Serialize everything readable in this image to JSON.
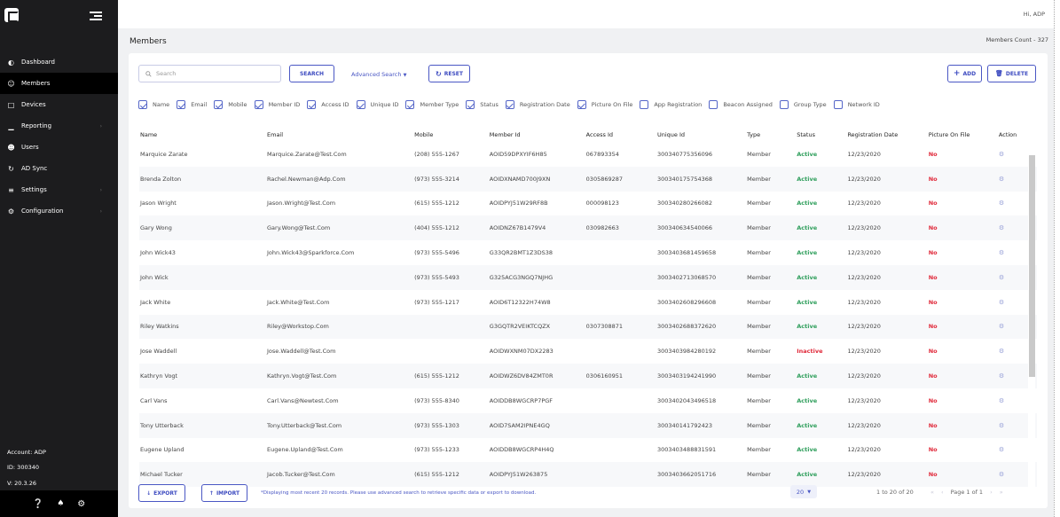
{
  "header": {
    "greeting": "Hi, ADP"
  },
  "sidebar": {
    "items": [
      {
        "label": "Dashboard",
        "icon": "palette-icon"
      },
      {
        "label": "Members",
        "icon": "members-icon"
      },
      {
        "label": "Devices",
        "icon": "device-icon"
      },
      {
        "label": "Reporting",
        "icon": "chart-icon"
      },
      {
        "label": "Users",
        "icon": "user-icon"
      },
      {
        "label": "AD Sync",
        "icon": "sync-icon"
      },
      {
        "label": "Settings",
        "icon": "sliders-icon"
      },
      {
        "label": "Configuration",
        "icon": "gear-icon"
      }
    ],
    "account": "Account: ADP",
    "id": "ID: 300340",
    "version": "V: 20.3.26"
  },
  "page": {
    "title": "Members",
    "count": "Members Count - 327"
  },
  "toolbar": {
    "search_placeholder": "Search",
    "search_button": "SEARCH",
    "advanced": "Advanced Search",
    "reset": "RESET",
    "add": "ADD",
    "delete": "DELETE"
  },
  "filters": [
    {
      "label": "Name",
      "checked": true
    },
    {
      "label": "Email",
      "checked": true
    },
    {
      "label": "Mobile",
      "checked": true
    },
    {
      "label": "Member ID",
      "checked": true
    },
    {
      "label": "Access ID",
      "checked": true
    },
    {
      "label": "Unique ID",
      "checked": true
    },
    {
      "label": "Member Type",
      "checked": true
    },
    {
      "label": "Status",
      "checked": true
    },
    {
      "label": "Registration Date",
      "checked": true
    },
    {
      "label": "Picture On File",
      "checked": true
    },
    {
      "label": "App Registration",
      "checked": false
    },
    {
      "label": "Beacon Assigned",
      "checked": false
    },
    {
      "label": "Group Type",
      "checked": false
    },
    {
      "label": "Network ID",
      "checked": false
    }
  ],
  "table": {
    "columns": [
      "Name",
      "Email",
      "Mobile",
      "Member Id",
      "Access Id",
      "Unique Id",
      "Type",
      "Status",
      "Registration Date",
      "Picture On File",
      "Action"
    ],
    "rows": [
      [
        "Marquice Zarate",
        "Marquice.Zarate@Test.Com",
        "(208) 555-1267",
        "AOID59DPXYIF6H85",
        "067893354",
        "300340775356096",
        "Member",
        "Active",
        "12/23/2020",
        "No"
      ],
      [
        "Brenda Zolton",
        "Rachel.Newman@Adp.Com",
        "(973) 555-3214",
        "AOIDXNAMD700J9XN",
        "0305869287",
        "300340175754368",
        "Member",
        "Active",
        "12/23/2020",
        "No"
      ],
      [
        "Jason Wright",
        "Jason.Wright@Test.Com",
        "(615) 555-1212",
        "AOIDPYJ51W29RF8B",
        "000098123",
        "300340280266082",
        "Member",
        "Active",
        "12/23/2020",
        "No"
      ],
      [
        "Gary Wong",
        "Gary.Wong@Test.Com",
        "(404) 555-1212",
        "AOIDNZ67B1479V4",
        "030982663",
        "300340634540066",
        "Member",
        "Active",
        "12/23/2020",
        "No"
      ],
      [
        "John Wick43",
        "John.Wick43@Sparkforce.Com",
        "(973) 555-5496",
        "G33QR2BMT1Z3DS38",
        "",
        "300340368145965​8",
        "Member",
        "Active",
        "12/23/2020",
        "No"
      ],
      [
        "John Wick",
        "",
        "(973) 555-5493",
        "G325ACG3NGQ7NJHG",
        "",
        "300340271306857​0",
        "Member",
        "Active",
        "12/23/2020",
        "No"
      ],
      [
        "Jack White",
        "Jack.White@Test.Com",
        "(973) 555-1217",
        "AOID6T12322H74W8",
        "",
        "300340260829660​8",
        "Member",
        "Active",
        "12/23/2020",
        "No"
      ],
      [
        "Riley Watkins",
        "Riley@Workstop.Com",
        "",
        "G3GQTR2VEIKTCQZX",
        "0307308871",
        "300340268837262​0",
        "Member",
        "Active",
        "12/23/2020",
        "No"
      ],
      [
        "Jose Waddell",
        "Jose.Waddell@Test.Com",
        "",
        "AOIDWXNM07DX2283",
        "",
        "300340398428019​2",
        "Member",
        "Inactive",
        "12/23/2020",
        "No"
      ],
      [
        "Kathryn Vogt",
        "Kathryn.Vogt@Test.Com",
        "(615) 555-1212",
        "AOIDWZ6DV84ZMT0R",
        "0306160951",
        "300340319424199​0",
        "Member",
        "Active",
        "12/23/2020",
        "No"
      ],
      [
        "Carl Vans",
        "Carl.Vans@Newtest.Com",
        "(973) 555-8340",
        "AOIDDB8WGCRP7PGF",
        "",
        "300340204349651​8",
        "Member",
        "Active",
        "12/23/2020",
        "No"
      ],
      [
        "Tony Utterback",
        "Tony.Utterback@Test.Com",
        "(973) 555-1303",
        "AOID7SAM2IPNE4GQ",
        "",
        "300340141792423",
        "Member",
        "Active",
        "12/23/2020",
        "No"
      ],
      [
        "Eugene Upland",
        "Eugene.Upland@Test.Com",
        "(973) 555-1233",
        "AOIDDB8WGCRP4H4Q",
        "",
        "300340348883159​1",
        "Member",
        "Active",
        "12/23/2020",
        "No"
      ],
      [
        "Michael Tucker",
        "Jacob.Tucker@Test.Com",
        "(615) 555-1212",
        "AOIDPYJ51W2​63875",
        "",
        "300340366205171​6",
        "Member",
        "Active",
        "12/23/2020",
        "No"
      ]
    ]
  },
  "footer": {
    "export": "EXPORT",
    "import": "IMPORT",
    "note": "*Displaying most recent 20 records. Please use advanced search to retrieve specific data or export to download.",
    "page_size": "20",
    "range": "1 to 20 of 20",
    "page": "Page 1 of 1"
  }
}
